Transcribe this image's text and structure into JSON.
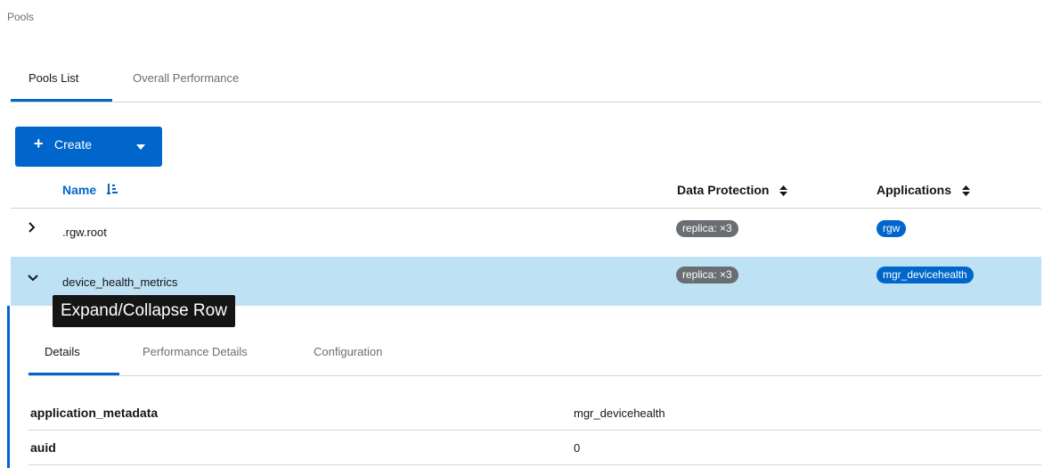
{
  "breadcrumb": "Pools",
  "tabs": [
    {
      "label": "Pools List",
      "active": true
    },
    {
      "label": "Overall Performance",
      "active": false
    }
  ],
  "toolbar": {
    "create_label": "Create"
  },
  "table": {
    "columns": {
      "name": "Name",
      "data_protection": "Data Protection",
      "applications": "Applications"
    },
    "rows": [
      {
        "name": ".rgw.root",
        "data_protection": "replica: ×3",
        "application": "rgw",
        "expanded": false
      },
      {
        "name": "device_health_metrics",
        "data_protection": "replica: ×3",
        "application": "mgr_devicehealth",
        "expanded": true
      }
    ]
  },
  "tooltip": "Expand/Collapse Row",
  "details": {
    "tabs": [
      {
        "label": "Details",
        "active": true
      },
      {
        "label": "Performance Details",
        "active": false
      },
      {
        "label": "Configuration",
        "active": false
      }
    ],
    "rows": [
      {
        "key": "application_metadata",
        "value": "mgr_devicehealth"
      },
      {
        "key": "auid",
        "value": "0"
      }
    ]
  },
  "colors": {
    "accent": "#0066cc",
    "selected_row": "#bee1f4",
    "badge_gray": "#6a6e73"
  }
}
